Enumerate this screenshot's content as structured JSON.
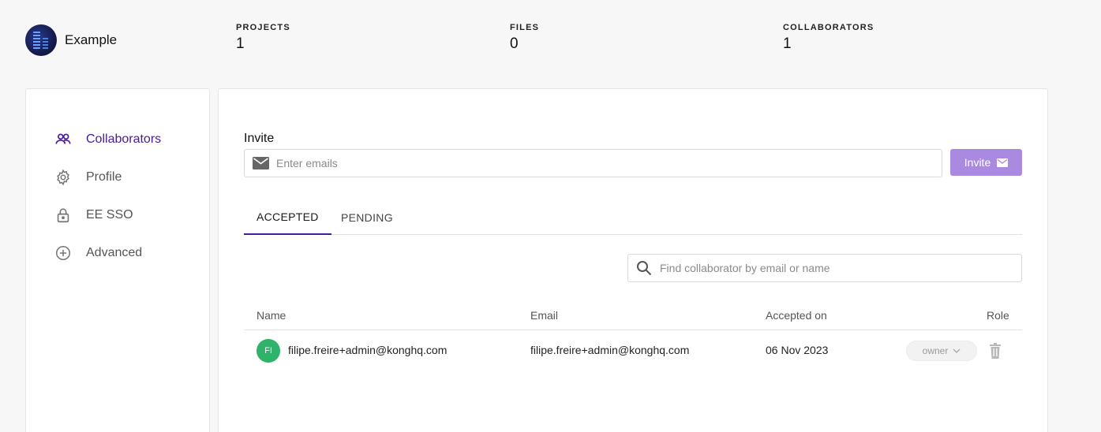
{
  "org": {
    "name": "Example",
    "avatar_icon": "org-avatar-icon"
  },
  "stats": [
    {
      "label": "PROJECTS",
      "value": "1"
    },
    {
      "label": "FILES",
      "value": "0"
    },
    {
      "label": "COLLABORATORS",
      "value": "1"
    }
  ],
  "sidebar": {
    "items": [
      {
        "label": "Collaborators",
        "icon": "users-icon",
        "active": true
      },
      {
        "label": "Profile",
        "icon": "gear-icon",
        "active": false
      },
      {
        "label": "EE SSO",
        "icon": "lock-icon",
        "active": false
      },
      {
        "label": "Advanced",
        "icon": "plus-circle-icon",
        "active": false
      }
    ]
  },
  "invite": {
    "title": "Invite",
    "placeholder": "Enter emails",
    "button_label": "Invite"
  },
  "tabs": [
    {
      "label": "ACCEPTED",
      "active": true
    },
    {
      "label": "PENDING",
      "active": false
    }
  ],
  "search": {
    "placeholder": "Find collaborator by email or name"
  },
  "table": {
    "columns": [
      "Name",
      "Email",
      "Accepted on",
      "Role"
    ],
    "rows": [
      {
        "initials": "FI",
        "name": "filipe.freire+admin@konghq.com",
        "email": "filipe.freire+admin@konghq.com",
        "accepted_on": "06 Nov 2023",
        "role": "owner"
      }
    ]
  },
  "colors": {
    "accent": "#4a1a9c",
    "button": "#a98ae0",
    "avatar_green": "#2fb36b"
  }
}
